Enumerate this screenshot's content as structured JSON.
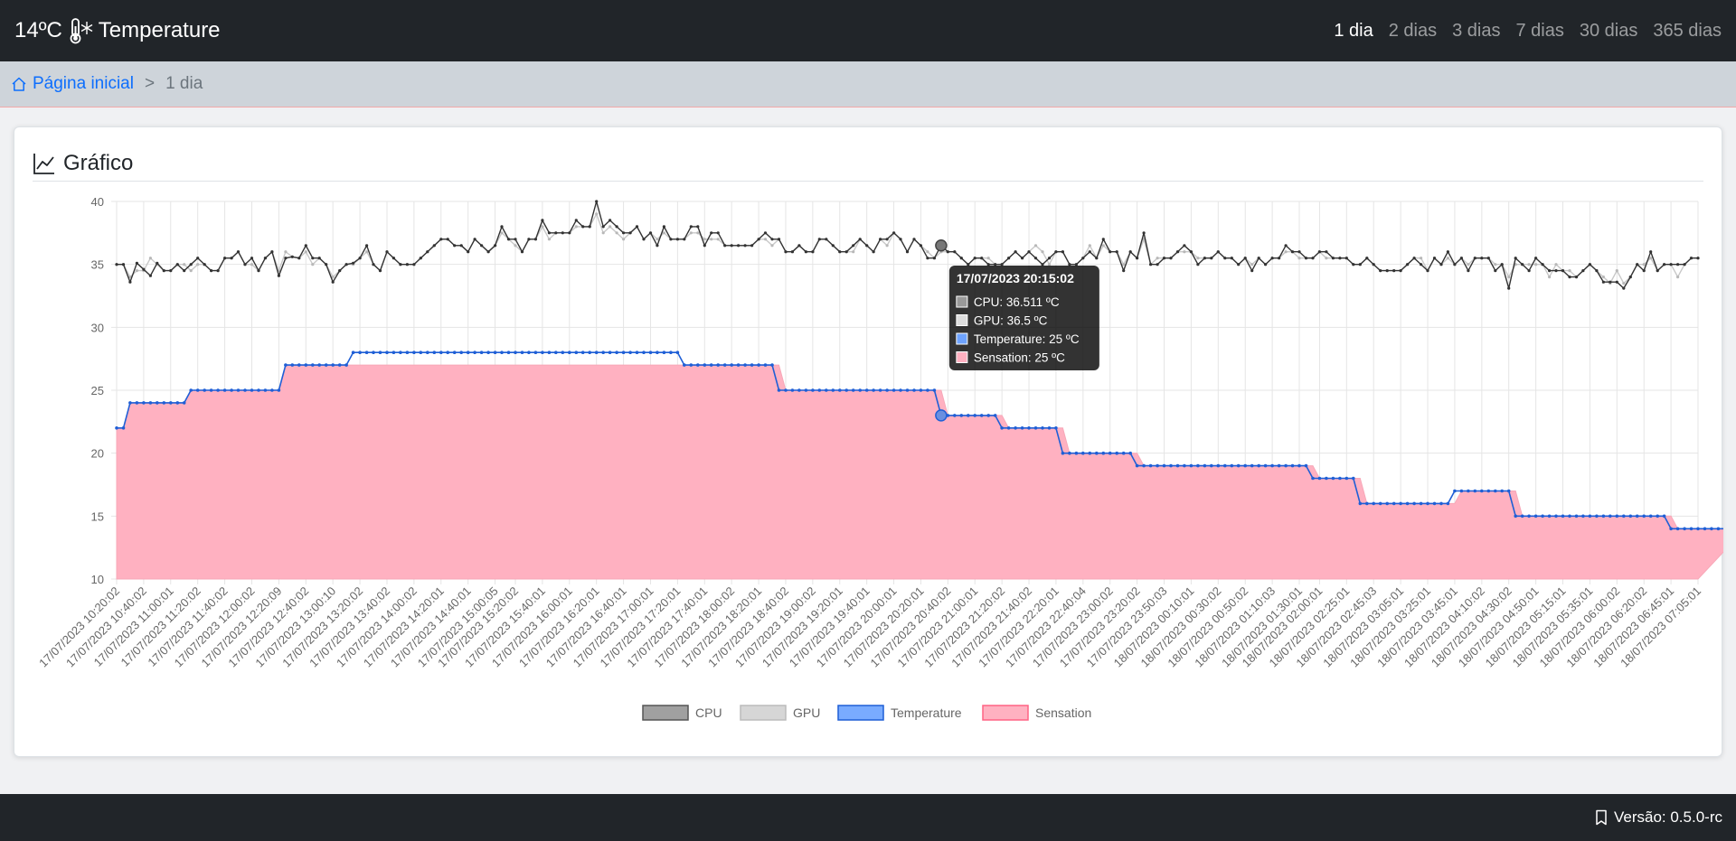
{
  "navbar": {
    "temperature": "14ºC",
    "title": "Temperature",
    "links": [
      {
        "label": "1 dia",
        "active": true
      },
      {
        "label": "2 dias"
      },
      {
        "label": "3 dias"
      },
      {
        "label": "7 dias"
      },
      {
        "label": "30 dias"
      },
      {
        "label": "365 dias"
      }
    ]
  },
  "breadcrumb": {
    "home": "Página inicial",
    "separator": ">",
    "current": "1 dia"
  },
  "card": {
    "title": "Gráfico"
  },
  "footer": {
    "version": "Versão: 0.5.0-rc"
  },
  "colors": {
    "navbar_bg": "#212529",
    "link_blue": "#0d6efd",
    "cpu": "#333333",
    "gpu": "#c8c8c8",
    "temperature": "#1f5fd6",
    "sensation_fill": "#ffb1c1"
  },
  "chart_data": {
    "type": "line",
    "ylim": [
      10,
      40
    ],
    "yticks": [
      10,
      15,
      20,
      25,
      30,
      35,
      40
    ],
    "grid": true,
    "legend_position": "bottom",
    "x_tick_labels": [
      "17/07/2023 10:20:02",
      "17/07/2023 10:40:02",
      "17/07/2023 11:00:01",
      "17/07/2023 11:20:02",
      "17/07/2023 11:40:02",
      "17/07/2023 12:00:02",
      "17/07/2023 12:20:09",
      "17/07/2023 12:40:02",
      "17/07/2023 13:00:10",
      "17/07/2023 13:20:02",
      "17/07/2023 13:40:02",
      "17/07/2023 14:00:02",
      "17/07/2023 14:20:01",
      "17/07/2023 14:40:01",
      "17/07/2023 15:00:05",
      "17/07/2023 15:20:02",
      "17/07/2023 15:40:01",
      "17/07/2023 16:00:01",
      "17/07/2023 16:20:01",
      "17/07/2023 16:40:01",
      "17/07/2023 17:00:01",
      "17/07/2023 17:20:01",
      "17/07/2023 17:40:01",
      "17/07/2023 18:00:02",
      "17/07/2023 18:20:01",
      "17/07/2023 18:40:02",
      "17/07/2023 19:00:02",
      "17/07/2023 19:20:01",
      "17/07/2023 19:40:01",
      "17/07/2023 20:00:01",
      "17/07/2023 20:20:01",
      "17/07/2023 20:40:02",
      "17/07/2023 21:00:01",
      "17/07/2023 21:20:02",
      "17/07/2023 21:40:02",
      "17/07/2023 22:20:01",
      "17/07/2023 22:40:04",
      "17/07/2023 23:00:02",
      "17/07/2023 23:20:02",
      "17/07/2023 23:50:03",
      "18/07/2023 00:10:01",
      "18/07/2023 00:30:02",
      "18/07/2023 00:50:02",
      "18/07/2023 01:10:03",
      "18/07/2023 01:30:01",
      "18/07/2023 02:00:01",
      "18/07/2023 02:25:01",
      "18/07/2023 02:45:03",
      "18/07/2023 03:05:01",
      "18/07/2023 03:25:01",
      "18/07/2023 03:45:01",
      "18/07/2023 04:10:02",
      "18/07/2023 04:30:02",
      "18/07/2023 04:50:01",
      "18/07/2023 05:15:01",
      "18/07/2023 05:35:01",
      "18/07/2023 06:00:02",
      "18/07/2023 06:20:02",
      "18/07/2023 06:45:01",
      "18/07/2023 07:05:01"
    ],
    "series": [
      {
        "name": "CPU",
        "values": [
          35.0,
          35.0,
          33.6,
          35.1,
          34.6,
          34.1,
          35.1,
          34.5,
          34.5,
          35.0,
          34.5,
          35.0,
          35.5,
          35.0,
          34.5,
          34.5,
          35.5,
          35.5,
          36.0,
          35.0,
          35.5,
          34.5,
          35.5,
          36.0,
          34.1,
          35.5,
          35.6,
          35.5,
          36.5,
          35.5,
          35.5,
          35.0,
          33.6,
          34.5,
          35.0,
          35.1,
          35.5,
          36.5,
          35.0,
          34.5,
          36.0,
          35.5,
          35.0,
          35.0,
          35.0,
          35.5,
          36.0,
          36.5,
          37.0,
          37.0,
          36.5,
          36.5,
          36.0,
          37.0,
          36.5,
          36.0,
          36.5,
          38.0,
          37.0,
          37.0,
          36.0,
          37.0,
          37.0,
          38.5,
          37.5,
          37.5,
          37.5,
          37.5,
          38.5,
          38.0,
          38.0,
          40.0,
          38.0,
          38.5,
          38.0,
          37.5,
          37.5,
          38.0,
          37.0,
          37.5,
          36.5,
          38.0,
          37.0,
          37.0,
          37.0,
          38.0,
          38.0,
          36.5,
          37.5,
          37.5,
          36.5,
          36.5,
          36.5,
          36.5,
          36.5,
          37.0,
          37.5,
          37.0,
          37.0,
          36.0,
          36.0,
          36.5,
          36.0,
          36.0,
          37.0,
          37.0,
          36.5,
          36.0,
          36.0,
          36.5,
          37.0,
          36.5,
          36.0,
          37.0,
          37.0,
          37.5,
          37.0,
          36.0,
          37.0,
          36.5,
          35.5,
          35.5,
          36.5,
          36.0,
          36.0,
          35.5,
          35.0,
          35.5,
          35.5,
          35.0,
          35.0,
          35.0,
          35.5,
          36.0,
          35.5,
          36.0,
          35.5,
          35.0,
          35.5,
          36.0,
          36.0,
          35.0,
          35.0,
          35.5,
          36.0,
          35.5,
          37.0,
          36.0,
          36.0,
          34.5,
          36.0,
          35.5,
          37.5,
          35.0,
          35.0,
          35.5,
          35.5,
          36.0,
          36.5,
          36.0,
          35.0,
          35.5,
          35.5,
          36.0,
          35.5,
          35.5,
          35.0,
          35.5,
          34.5,
          35.5,
          35.0,
          35.5,
          35.5,
          36.5,
          36.0,
          36.0,
          35.5,
          35.5,
          36.0,
          36.0,
          35.5,
          35.5,
          35.5,
          35.0,
          35.0,
          35.5,
          35.0,
          34.5,
          34.5,
          34.5,
          34.5,
          35.0,
          35.5,
          35.0,
          34.5,
          35.5,
          35.0,
          36.0,
          35.0,
          35.5,
          34.5,
          35.5,
          35.5,
          35.5,
          34.5,
          35.0,
          33.1,
          35.5,
          35.0,
          34.5,
          35.5,
          35.0,
          34.5,
          34.5,
          34.5,
          34.0,
          34.0,
          34.5,
          35.0,
          34.5,
          33.6,
          33.6,
          33.6,
          33.1,
          34.0,
          35.0,
          34.5,
          36.0,
          34.5,
          35.0,
          35.0,
          35.0,
          35.0,
          35.5,
          35.5
        ]
      },
      {
        "name": "GPU",
        "values": [
          35.0,
          35.0,
          34.0,
          34.5,
          34.5,
          35.5,
          35.0,
          34.5,
          34.5,
          35.0,
          35.0,
          34.5,
          35.0,
          35.0,
          34.5,
          34.5,
          35.5,
          35.5,
          36.0,
          35.0,
          35.0,
          34.5,
          35.5,
          36.0,
          34.5,
          36.0,
          35.6,
          35.5,
          36.0,
          35.0,
          35.5,
          35.0,
          34.0,
          34.5,
          35.0,
          35.0,
          35.5,
          36.0,
          35.0,
          34.5,
          36.0,
          35.5,
          35.0,
          35.0,
          35.0,
          35.5,
          36.0,
          36.5,
          37.0,
          37.0,
          36.5,
          36.5,
          36.0,
          37.0,
          36.5,
          36.0,
          36.5,
          37.5,
          37.0,
          36.5,
          36.0,
          37.0,
          37.0,
          38.0,
          37.0,
          37.5,
          37.5,
          37.5,
          38.0,
          38.0,
          38.0,
          39.0,
          37.5,
          38.0,
          37.5,
          37.0,
          37.5,
          38.0,
          37.0,
          37.5,
          37.0,
          37.5,
          37.0,
          37.0,
          37.0,
          37.5,
          37.5,
          37.0,
          37.0,
          37.0,
          36.5,
          36.5,
          36.5,
          36.5,
          36.5,
          37.0,
          37.0,
          36.5,
          37.0,
          36.0,
          36.0,
          36.5,
          36.0,
          36.0,
          37.0,
          37.0,
          36.5,
          36.0,
          36.0,
          36.0,
          37.0,
          36.5,
          36.0,
          37.0,
          36.5,
          37.5,
          37.0,
          36.0,
          37.0,
          36.5,
          36.0,
          35.5,
          36.0,
          36.0,
          36.0,
          35.5,
          35.0,
          35.5,
          35.5,
          35.5,
          35.0,
          35.0,
          35.5,
          36.0,
          35.5,
          36.0,
          36.5,
          36.0,
          35.0,
          36.0,
          36.0,
          35.0,
          35.0,
          35.5,
          36.5,
          35.5,
          36.5,
          36.0,
          36.0,
          35.0,
          36.0,
          35.5,
          37.0,
          35.0,
          35.5,
          35.5,
          35.5,
          36.0,
          36.0,
          36.0,
          35.5,
          35.5,
          35.5,
          36.0,
          35.5,
          35.5,
          35.0,
          35.5,
          35.0,
          35.5,
          35.0,
          35.5,
          35.5,
          36.0,
          36.0,
          35.5,
          35.5,
          35.5,
          36.0,
          35.5,
          35.5,
          35.5,
          35.5,
          35.0,
          35.0,
          35.5,
          35.0,
          34.5,
          34.5,
          34.5,
          34.5,
          35.0,
          35.5,
          35.5,
          34.5,
          35.5,
          35.0,
          35.5,
          35.0,
          35.5,
          35.0,
          35.5,
          35.5,
          35.5,
          35.0,
          35.0,
          34.0,
          35.0,
          35.0,
          35.0,
          35.0,
          35.0,
          34.0,
          35.0,
          34.5,
          34.5,
          34.0,
          34.5,
          35.0,
          34.5,
          34.0,
          33.5,
          34.5,
          33.5,
          34.0,
          35.0,
          35.0,
          35.5,
          34.5,
          35.0,
          35.0,
          34.0,
          35.0,
          35.5,
          35.5
        ]
      },
      {
        "name": "Temperature",
        "segments": [
          [
            22,
            2
          ],
          [
            24,
            9
          ],
          [
            25,
            14
          ],
          [
            27,
            10
          ],
          [
            28,
            49
          ],
          [
            27,
            14
          ],
          [
            25,
            24
          ],
          [
            23,
            9
          ],
          [
            22,
            9
          ],
          [
            20,
            11
          ],
          [
            19,
            26
          ],
          [
            18,
            7
          ],
          [
            16,
            14
          ],
          [
            17,
            9
          ],
          [
            15,
            23
          ],
          [
            14,
            11
          ]
        ]
      },
      {
        "name": "Sensation",
        "segments": [
          [
            22,
            2
          ],
          [
            24,
            9
          ],
          [
            25,
            14
          ],
          [
            27,
            74
          ],
          [
            25,
            24
          ],
          [
            23,
            9
          ],
          [
            22,
            9
          ],
          [
            20,
            11
          ],
          [
            19,
            26
          ],
          [
            18,
            7
          ],
          [
            16,
            14
          ],
          [
            17,
            9
          ],
          [
            15,
            23
          ],
          [
            14,
            11
          ]
        ]
      }
    ],
    "tooltip": {
      "title": "17/07/2023 20:15:02",
      "index": 122,
      "items": [
        {
          "series": "CPU",
          "text": "CPU: 36.511 ºC"
        },
        {
          "series": "GPU",
          "text": "GPU: 36.5 ºC"
        },
        {
          "series": "Temperature",
          "text": "Temperature: 25 ºC"
        },
        {
          "series": "Sensation",
          "text": "Sensation: 25 ºC"
        }
      ]
    }
  }
}
